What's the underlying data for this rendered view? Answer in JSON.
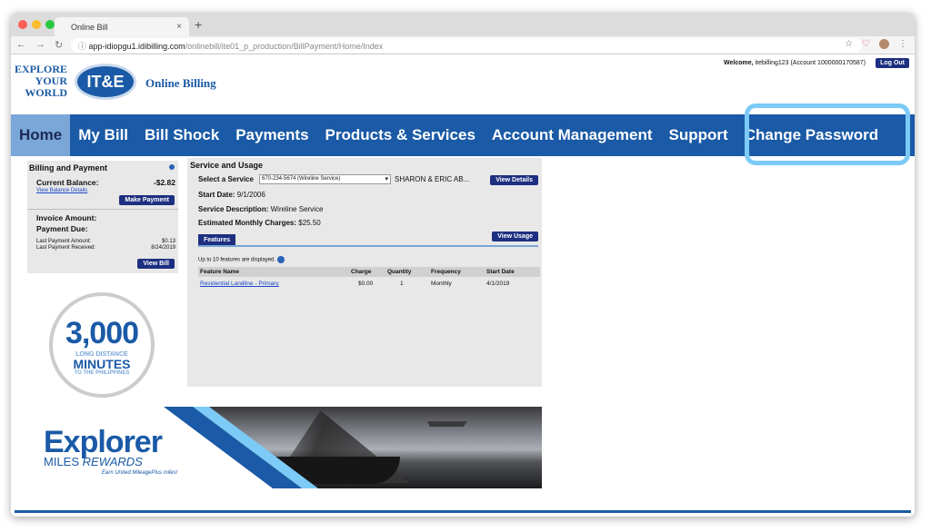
{
  "browser": {
    "tab_title": "Online Bill",
    "tab_close": "×",
    "new_tab": "+",
    "url_host": "app-idiopgu1.idibilling.com",
    "url_path": "/onlinebill/ite01_p_production/BillPayment/Home/Index"
  },
  "header": {
    "logo_line1": "EXPLORE",
    "logo_line2": "YOUR",
    "logo_line3": "WORLD",
    "logo_mark": "IT&E",
    "brand": "Online Billing",
    "welcome_prefix": "Welcome,",
    "welcome_user": "itebilling123 (Account 1000000170587)",
    "logout": "Log Out"
  },
  "nav": {
    "home": "Home",
    "my_bill": "My Bill",
    "bill_shock": "Bill Shock",
    "payments": "Payments",
    "products": "Products & Services",
    "account": "Account Management",
    "support": "Support",
    "change_password": "Change Password"
  },
  "billing": {
    "title": "Billing and Payment",
    "current_balance_label": "Current Balance:",
    "current_balance": "-$2.82",
    "view_balance_details": "View Balance Details",
    "make_payment": "Make Payment",
    "invoice_amount_label": "Invoice Amount:",
    "payment_due_label": "Payment Due:",
    "last_payment_amount_label": "Last Payment Amount:",
    "last_payment_amount": "$0.13",
    "last_payment_received_label": "Last Payment Received:",
    "last_payment_received": "8/24/2019",
    "view_bill": "View Bill"
  },
  "service": {
    "title": "Service and Usage",
    "select_label": "Select a Service",
    "selected_service": "670-234-5674 (Wireline Service)",
    "customer": "SHARON & ERIC AB...",
    "view_details": "View Details",
    "start_date_label": "Start Date:",
    "start_date": "9/1/2006",
    "description_label": "Service Description:",
    "description": "Wireline Service",
    "charges_label": "Estimated Monthly Charges:",
    "charges": "$25.50",
    "features_tab": "Features",
    "view_usage": "View Usage",
    "up_to_note": "Up to 10 features are displayed.",
    "columns": [
      "Feature Name",
      "Charge",
      "Quantity",
      "Frequency",
      "Start Date"
    ],
    "rows": [
      {
        "name": "Residential Landline - Primary",
        "charge": "$0.00",
        "quantity": "1",
        "frequency": "Monthly",
        "start": "4/1/2019"
      }
    ]
  },
  "promo": {
    "number": "3,000",
    "line1": "LONG DISTANCE",
    "line2": "MINUTES",
    "line3": "TO THE PHILIPPINES"
  },
  "banner": {
    "title": "Explorer",
    "miles": "MILES",
    "rewards": "REWARDS",
    "earn": "Earn United MileagePlus miles!"
  },
  "colors": {
    "nav_blue": "#1a5aa6",
    "button_navy": "#1d2f80",
    "highlight": "#7ccaf6"
  }
}
